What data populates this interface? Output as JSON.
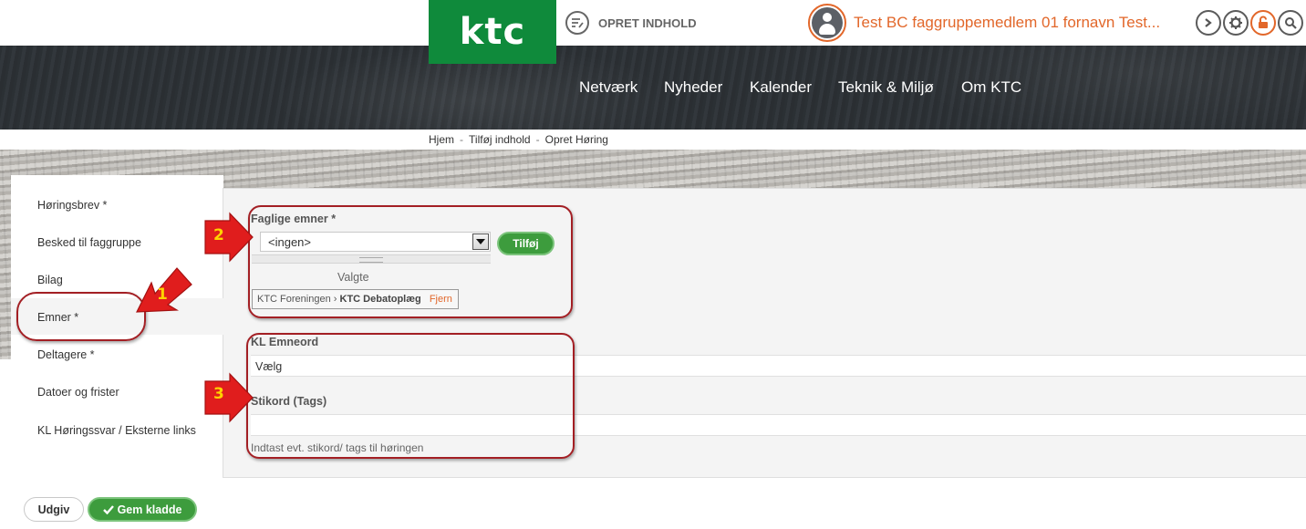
{
  "header": {
    "logo_text": "ktc",
    "create_label": "OPRET INDHOLD",
    "user_name": "Test BC faggruppemedlem 01 fornavn Test...",
    "colors": {
      "brand_green": "#0f8a3b",
      "accent_orange": "#e2672a",
      "button_green": "#3d9c3d"
    }
  },
  "nav": {
    "items": [
      "Netværk",
      "Nyheder",
      "Kalender",
      "Teknik & Miljø",
      "Om KTC"
    ]
  },
  "breadcrumb": {
    "items": [
      "Hjem",
      "Tilføj indhold",
      "Opret Høring"
    ],
    "separator": "-"
  },
  "sidebar": {
    "items": [
      "Høringsbrev *",
      "Besked til faggruppe",
      "Bilag",
      "Emner *",
      "Deltagere *",
      "Datoer og frister",
      "KL Høringssvar / Eksterne links"
    ]
  },
  "form": {
    "topics_label": "Faglige emner *",
    "topics_select_value": "<ingen>",
    "add_button": "Tilføj",
    "chosen_label": "Valgte",
    "chosen_item_parent": "KTC Foreningen",
    "chosen_item_sep": "›",
    "chosen_item_name": "KTC Debatoplæg",
    "chosen_remove": "Fjern",
    "kl_keywords_label": "KL Emneord",
    "kl_keywords_value": "Vælg",
    "tags_label": "Stikord (Tags)",
    "tags_value": "",
    "tags_hint": "Indtast evt. stikord/ tags til høringen"
  },
  "actions": {
    "publish": "Udgiv",
    "save_draft": "Gem kladde"
  },
  "annotations": {
    "numbers": [
      "1",
      "2",
      "3"
    ],
    "color": "#a31f24"
  }
}
